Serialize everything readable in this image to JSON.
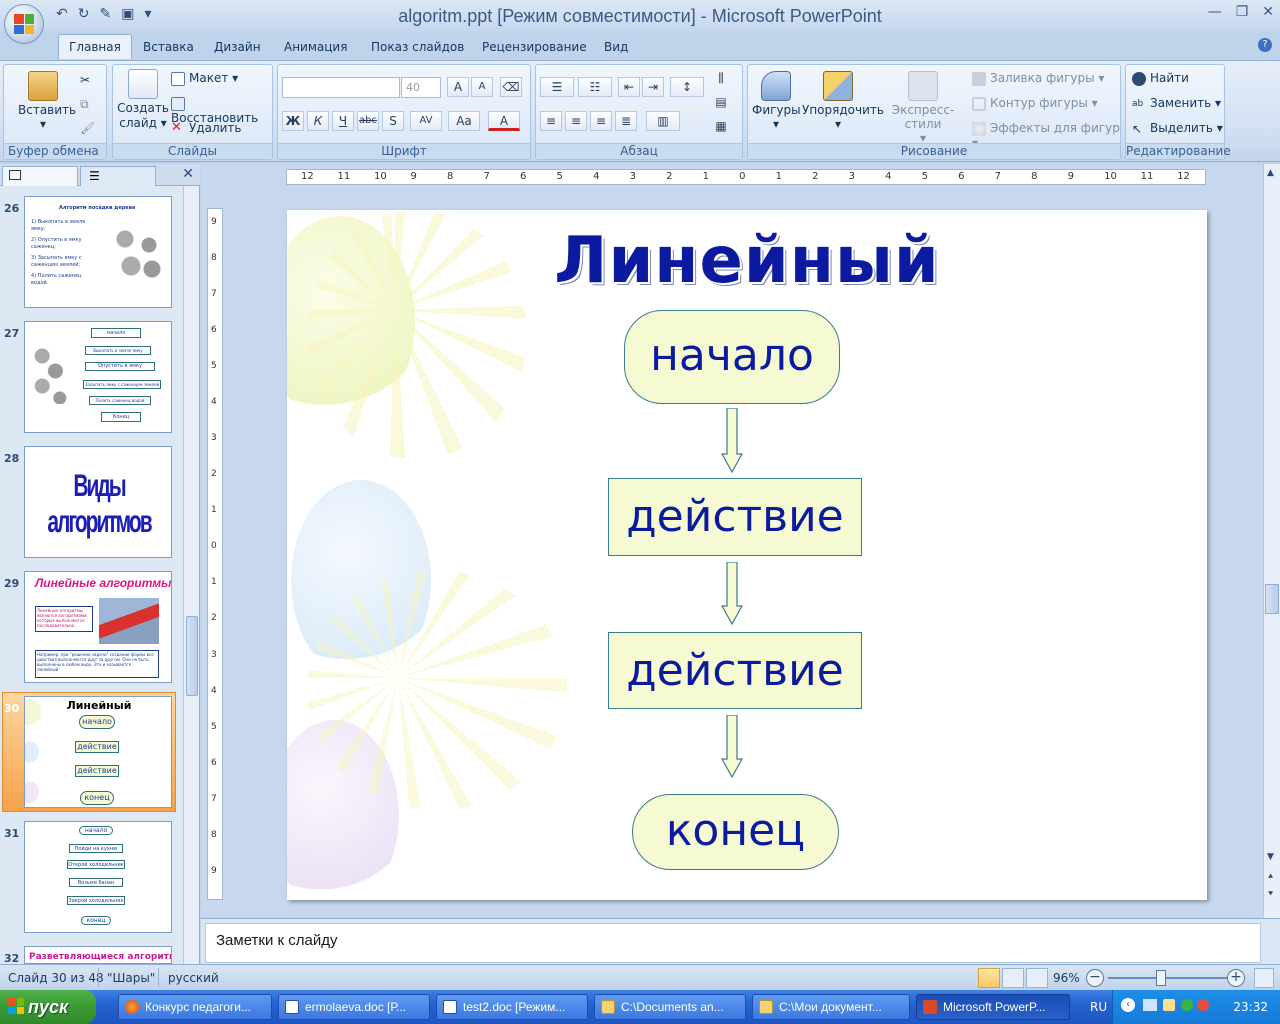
{
  "window": {
    "title": "algoritm.ppt [Режим совместимости] - Microsoft PowerPoint"
  },
  "tabs": [
    "Главная",
    "Вставка",
    "Дизайн",
    "Анимация",
    "Показ слайдов",
    "Рецензирование",
    "Вид"
  ],
  "ribbon": {
    "clipboard": {
      "label": "Буфер обмена",
      "paste": "Вставить"
    },
    "slides": {
      "label": "Слайды",
      "new_slide_1": "Создать",
      "new_slide_2": "слайд",
      "layout": "Макет",
      "reset": "Восстановить",
      "delete": "Удалить"
    },
    "font": {
      "label": "Шрифт",
      "font_name": "",
      "font_size": "40"
    },
    "paragraph": {
      "label": "Абзац"
    },
    "drawing": {
      "label": "Рисование",
      "shapes": "Фигуры",
      "arrange": "Упорядочить",
      "quick_styles": "Экспресс-стили",
      "fill": "Заливка фигуры",
      "outline": "Контур фигуры",
      "effects": "Эффекты для фигур"
    },
    "editing": {
      "label": "Редактирование",
      "find": "Найти",
      "replace": "Заменить",
      "select": "Выделить"
    }
  },
  "thumbnails": [
    {
      "num": "26",
      "title": "Алгоритм посадки дерева",
      "lines": [
        "1) Выкопать в земле ямку;",
        "2) Опустить в ямку саженец;",
        "3) Засыпать ямку с саженцем землей;",
        "4) Полить саженец водой."
      ]
    },
    {
      "num": "27",
      "boxes": [
        "начало",
        "Выкопать в земле ямку",
        "Опустить в ямку саженец",
        "Засыпать ямку с саженцем землей",
        "Полить саженец водой",
        "Конец"
      ]
    },
    {
      "num": "28",
      "title": "Виды алгоритмов"
    },
    {
      "num": "29",
      "title": "Линейные алгоритмы",
      "text1": "Линейные алгоритмы являются алгоритмами, которые выполняются последовательно.",
      "text2": "Например, при \"решении задачи\" создании формы все действия выполняются друг за другом. Они не быть выполнены в любом виде. Это и называется - линейный."
    },
    {
      "num": "30",
      "title": "Линейный",
      "boxes": [
        "начало",
        "действие",
        "действие",
        "конец"
      ]
    },
    {
      "num": "31",
      "boxes": [
        "начало",
        "Пойди на кухню",
        "Открой холодильник",
        "Возьми банан",
        "Закрой холодильник",
        "конец"
      ]
    },
    {
      "num": "32",
      "title": "Разветвляющиеся алгоритмы"
    }
  ],
  "ruler": {
    "h_labels": [
      "12",
      "11",
      "10",
      "9",
      "8",
      "7",
      "6",
      "5",
      "4",
      "3",
      "2",
      "1",
      "0",
      "1",
      "2",
      "3",
      "4",
      "5",
      "6",
      "7",
      "8",
      "9",
      "10",
      "11",
      "12"
    ],
    "v_labels": [
      "9",
      "8",
      "7",
      "6",
      "5",
      "4",
      "3",
      "2",
      "1",
      "0",
      "1",
      "2",
      "3",
      "4",
      "5",
      "6",
      "7",
      "8",
      "9"
    ]
  },
  "slide": {
    "title": "Линейный",
    "flow": [
      "начало",
      "действие",
      "действие",
      "конец"
    ],
    "colors": {
      "title": "#0b1a9e",
      "shape_fill": "#f5fad2",
      "shape_border": "#3a7d8a",
      "arrow_fill": "#f5fad2"
    }
  },
  "notes": {
    "placeholder": "Заметки к слайду"
  },
  "status": {
    "slide_info": "Слайд 30 из 48",
    "theme": "\"Шары\"",
    "language": "русский",
    "zoom": "96%"
  },
  "taskbar": {
    "start": "пуск",
    "items": [
      "Конкурс педагоги...",
      "ermolaeva.doc [Р...",
      "test2.doc [Режим...",
      "C:\\Documents an...",
      "C:\\Мои документ...",
      "Microsoft PowerP..."
    ],
    "lang": "RU",
    "clock": "23:32"
  }
}
